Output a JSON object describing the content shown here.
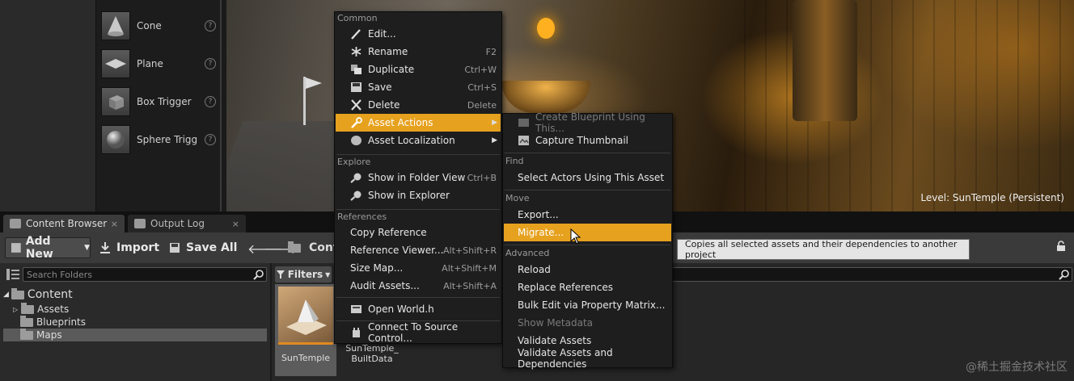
{
  "place_panel": {
    "items": [
      {
        "label": "Cone",
        "icon": "cone-icon"
      },
      {
        "label": "Plane",
        "icon": "plane-icon"
      },
      {
        "label": "Box Trigger",
        "icon": "box-trigger-icon"
      },
      {
        "label": "Sphere Trigg",
        "icon": "sphere-trigger-icon"
      }
    ],
    "help_glyph": "?"
  },
  "viewport": {
    "level_label": "Level:  SunTemple (Persistent)"
  },
  "tabs": [
    {
      "label": "Content Browser",
      "close": "×"
    },
    {
      "label": "Output Log",
      "close": "×"
    }
  ],
  "toolbar": {
    "add_new": "Add New",
    "import": "Import",
    "save_all": "Save All",
    "breadcrumb": "Cont"
  },
  "folders": {
    "search_placeholder": "Search Folders",
    "tree": [
      {
        "label": "Content"
      },
      {
        "label": "Assets"
      },
      {
        "label": "Blueprints"
      },
      {
        "label": "Maps",
        "selected": true
      }
    ]
  },
  "assets": {
    "filters_label": "Filters",
    "tiles": [
      {
        "name": "SunTemple",
        "selected": true
      },
      {
        "name": "SunTemple_\nBuiltData",
        "selected": false
      }
    ]
  },
  "context_menu": {
    "sections": {
      "common": "Common",
      "explore": "Explore",
      "references": "References"
    },
    "items": {
      "edit": {
        "label": "Edit..."
      },
      "rename": {
        "label": "Rename",
        "shortcut": "F2"
      },
      "duplicate": {
        "label": "Duplicate",
        "shortcut": "Ctrl+W"
      },
      "save": {
        "label": "Save",
        "shortcut": "Ctrl+S"
      },
      "delete": {
        "label": "Delete",
        "shortcut": "Delete"
      },
      "asset_actions": {
        "label": "Asset Actions"
      },
      "asset_localization": {
        "label": "Asset Localization"
      },
      "show_in_folder_view": {
        "label": "Show in Folder View",
        "shortcut": "Ctrl+B"
      },
      "show_in_explorer": {
        "label": "Show in Explorer"
      },
      "copy_reference": {
        "label": "Copy Reference"
      },
      "reference_viewer": {
        "label": "Reference Viewer...",
        "shortcut": "Alt+Shift+R"
      },
      "size_map": {
        "label": "Size Map...",
        "shortcut": "Alt+Shift+M"
      },
      "audit_assets": {
        "label": "Audit Assets...",
        "shortcut": "Alt+Shift+A"
      },
      "open_world_h": {
        "label": "Open World.h"
      },
      "connect_source_control": {
        "label": "Connect To Source Control..."
      }
    }
  },
  "submenu": {
    "sections": {
      "find": "Find",
      "move": "Move",
      "advanced": "Advanced"
    },
    "items": {
      "create_blueprint": {
        "label": "Create Blueprint Using This..."
      },
      "capture_thumbnail": {
        "label": "Capture Thumbnail"
      },
      "select_actors": {
        "label": "Select Actors Using This Asset"
      },
      "export": {
        "label": "Export..."
      },
      "migrate": {
        "label": "Migrate..."
      },
      "reload": {
        "label": "Reload"
      },
      "replace_references": {
        "label": "Replace References"
      },
      "bulk_edit": {
        "label": "Bulk Edit via Property Matrix..."
      },
      "show_metadata": {
        "label": "Show Metadata"
      },
      "validate_assets": {
        "label": "Validate Assets"
      },
      "validate_assets_deps": {
        "label": "Validate Assets and Dependencies"
      }
    }
  },
  "tooltip": "Copies all selected assets and their dependencies to another project",
  "watermark": "@稀土掘金技术社区",
  "colors": {
    "highlight": "#e6a11e",
    "menu_bg": "#1e1e1e",
    "tooltip_bg": "#e4e4e4"
  }
}
